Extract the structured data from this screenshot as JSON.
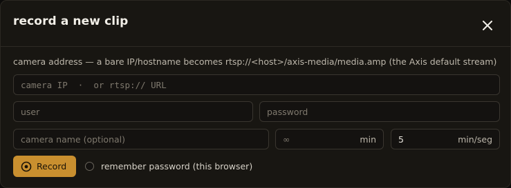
{
  "modal": {
    "title": "record a new clip",
    "hint": "camera address — a bare IP/hostname becomes rtsp://<host>/axis-media/media.amp (the Axis default stream)"
  },
  "fields": {
    "address": {
      "placeholder": "camera IP  ·  or rtsp:// URL",
      "value": ""
    },
    "user": {
      "placeholder": "user",
      "value": ""
    },
    "password": {
      "placeholder": "password",
      "value": ""
    },
    "camera_name": {
      "placeholder": "camera name (optional)",
      "value": ""
    },
    "duration": {
      "placeholder": "∞",
      "value": "",
      "unit": "min"
    },
    "segment": {
      "value": "5",
      "unit": "min/seg"
    }
  },
  "actions": {
    "record_label": "Record",
    "remember_label": "remember password (this browser)",
    "remember_checked": false
  },
  "colors": {
    "accent": "#c98f2f",
    "background": "#181612",
    "border": "#3a3630"
  }
}
